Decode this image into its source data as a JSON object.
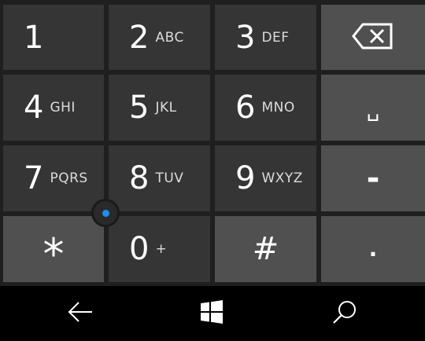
{
  "keypad": {
    "keys": [
      {
        "digit": "1",
        "letters": ""
      },
      {
        "digit": "2",
        "letters": "ABC"
      },
      {
        "digit": "3",
        "letters": "DEF"
      },
      {
        "digit": "4",
        "letters": "GHI"
      },
      {
        "digit": "5",
        "letters": "JKL"
      },
      {
        "digit": "6",
        "letters": "MNO"
      },
      {
        "digit": "7",
        "letters": "PQRS"
      },
      {
        "digit": "8",
        "letters": "TUV"
      },
      {
        "digit": "9",
        "letters": "WXYZ"
      },
      {
        "digit": "0",
        "letters": "+"
      }
    ],
    "symbols": {
      "star": "*",
      "hash": "#",
      "minus": "-",
      "dot": ".",
      "space": "␣"
    },
    "backspace_icon": "backspace-icon"
  },
  "navbar": {
    "back_icon": "back-arrow-icon",
    "home_icon": "windows-logo-icon",
    "search_icon": "search-icon"
  },
  "colors": {
    "key_dark": "#353535",
    "key_light": "#505050",
    "background": "#1f1f1f",
    "navbar": "#000000",
    "cursor_accent": "#1e8ef0"
  }
}
